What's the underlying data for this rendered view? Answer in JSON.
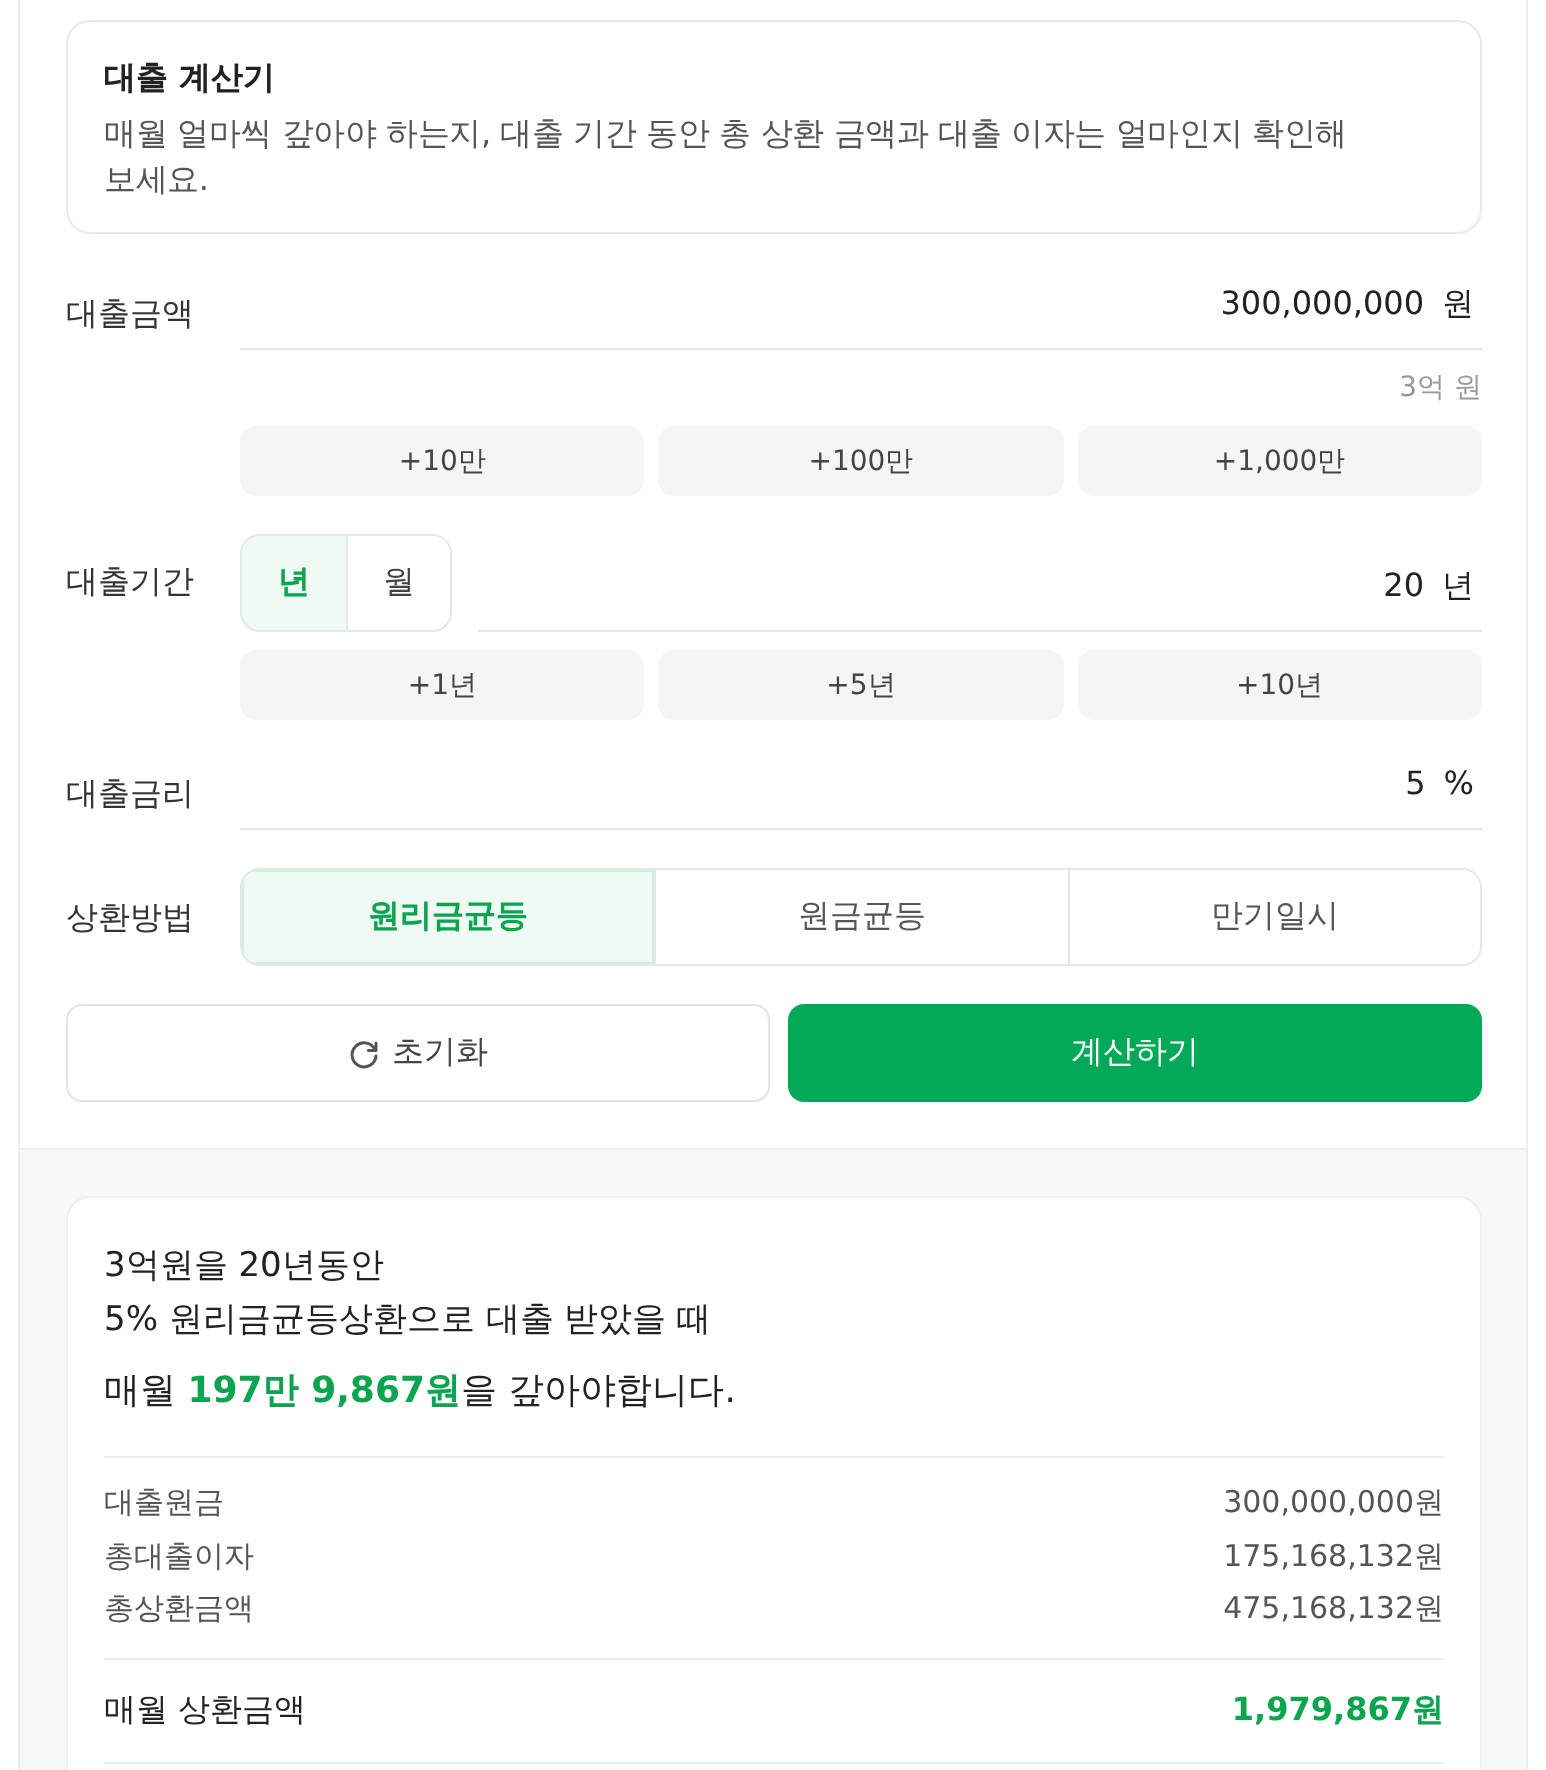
{
  "intro": {
    "title": "대출 계산기",
    "description": "매월 얼마씩 갚아야 하는지, 대출 기간 동안 총 상환 금액과 대출 이자는 얼마인지 확인해 보세요."
  },
  "amount": {
    "label": "대출금액",
    "value": "300,000,000",
    "unit": "원",
    "hint": "3억 원",
    "quick_buttons": [
      "+10만",
      "+100만",
      "+1,000만"
    ]
  },
  "period": {
    "label": "대출기간",
    "unit_toggle": [
      {
        "label": "년",
        "selected": true
      },
      {
        "label": "월",
        "selected": false
      }
    ],
    "value": "20",
    "unit": "년",
    "quick_buttons": [
      "+1년",
      "+5년",
      "+10년"
    ]
  },
  "rate": {
    "label": "대출금리",
    "value": "5",
    "unit": "%"
  },
  "method": {
    "label": "상환방법",
    "options": [
      {
        "label": "원리금균등",
        "selected": true
      },
      {
        "label": "원금균등",
        "selected": false
      },
      {
        "label": "만기일시",
        "selected": false
      }
    ]
  },
  "actions": [
    {
      "kind": "reset",
      "label": "초기화"
    },
    {
      "kind": "primary",
      "label": "계산하기"
    }
  ],
  "result": {
    "summary_lines": [
      "3억원을 20년동안",
      "5% 원리금균등상환으로 대출 받았을 때"
    ],
    "headline": "매월 **197만 9,867원**을 갚아야합니다.",
    "details": [
      {
        "label": "대출원금",
        "value": "300,000,000원"
      },
      {
        "label": "총대출이자",
        "value": "175,168,132원"
      },
      {
        "label": "총상환금액",
        "value": "475,168,132원"
      }
    ],
    "monthly": {
      "label": "매월 상환금액",
      "value": "1,979,867원"
    }
  }
}
